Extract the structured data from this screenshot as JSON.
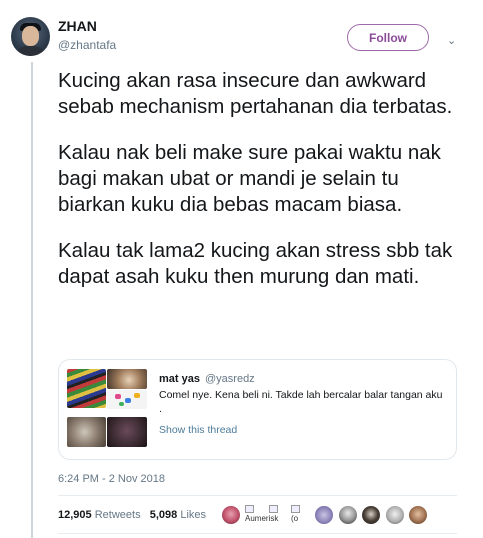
{
  "author": {
    "name": "ZHAN",
    "handle": "@zhantafa"
  },
  "follow_label": "Follow",
  "tweet_paragraphs": [
    "Kucing akan rasa insecure dan awkward sebab mechanism pertahanan dia terbatas.",
    "Kalau nak beli make sure pakai waktu nak bagi makan ubat or mandi je selain tu biarkan kuku dia bebas macam biasa.",
    "Kalau tak lama2 kucing akan stress  sbb tak dapat asah kuku then murung dan mati."
  ],
  "quoted": {
    "name": "mat yas",
    "handle": "@yasredz",
    "text": "Comel nye. Kena beli ni. Takde lah bercalar balar tangan aku .",
    "link": "Show this thread"
  },
  "timestamp": "6:24 PM - 2 Nov 2018",
  "stats": {
    "retweets_count": "12,905",
    "retweets_label": "Retweets",
    "likes_count": "5,098",
    "likes_label": "Likes"
  },
  "liker_alt_texts": [
    "Aumerisk",
    "(o"
  ],
  "colors": {
    "follow_border": "#9c6aa8",
    "link": "#4d7b99",
    "secondary_text": "#657786"
  },
  "icons": [
    "chevron-down-icon"
  ]
}
